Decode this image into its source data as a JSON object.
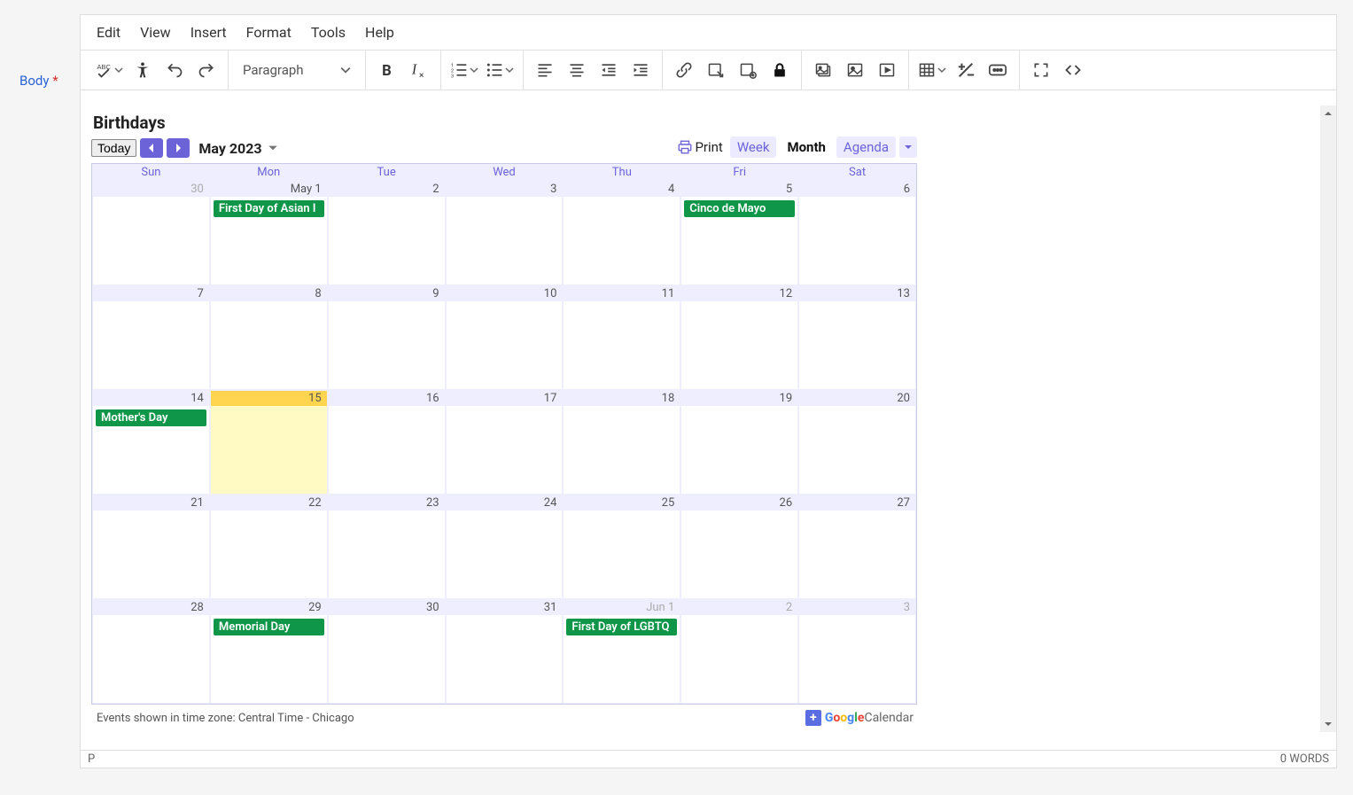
{
  "label": {
    "body": "Body",
    "req": "*"
  },
  "menus": {
    "edit": "Edit",
    "view": "View",
    "insert": "Insert",
    "format": "Format",
    "tools": "Tools",
    "help": "Help"
  },
  "toolbar": {
    "block_format": "Paragraph"
  },
  "calendar": {
    "title": "Birthdays",
    "today": "Today",
    "month_label": "May 2023",
    "print": "Print",
    "views": {
      "week": "Week",
      "month": "Month",
      "agenda": "Agenda"
    },
    "dayheads": [
      "Sun",
      "Mon",
      "Tue",
      "Wed",
      "Thu",
      "Fri",
      "Sat"
    ],
    "weeks": [
      [
        {
          "label": "30",
          "outside": true
        },
        {
          "label": "May 1",
          "events": [
            "First Day of Asian I"
          ]
        },
        {
          "label": "2"
        },
        {
          "label": "3"
        },
        {
          "label": "4"
        },
        {
          "label": "5",
          "events": [
            "Cinco de Mayo"
          ]
        },
        {
          "label": "6"
        }
      ],
      [
        {
          "label": "7"
        },
        {
          "label": "8"
        },
        {
          "label": "9"
        },
        {
          "label": "10"
        },
        {
          "label": "11"
        },
        {
          "label": "12"
        },
        {
          "label": "13"
        }
      ],
      [
        {
          "label": "14",
          "events": [
            "Mother's Day"
          ]
        },
        {
          "label": "15",
          "today": true
        },
        {
          "label": "16"
        },
        {
          "label": "17"
        },
        {
          "label": "18"
        },
        {
          "label": "19"
        },
        {
          "label": "20"
        }
      ],
      [
        {
          "label": "21"
        },
        {
          "label": "22"
        },
        {
          "label": "23"
        },
        {
          "label": "24"
        },
        {
          "label": "25"
        },
        {
          "label": "26"
        },
        {
          "label": "27"
        }
      ],
      [
        {
          "label": "28"
        },
        {
          "label": "29",
          "events": [
            "Memorial Day"
          ]
        },
        {
          "label": "30"
        },
        {
          "label": "31"
        },
        {
          "label": "Jun 1",
          "outside": true,
          "events": [
            "First Day of LGBTQ"
          ]
        },
        {
          "label": "2",
          "outside": true
        },
        {
          "label": "3",
          "outside": true
        }
      ]
    ],
    "tz_footer": "Events shown in time zone: Central Time - Chicago",
    "gcal": {
      "google": "Google",
      "calendar": "Calendar"
    }
  },
  "status": {
    "path": "P",
    "words": "0 WORDS"
  }
}
